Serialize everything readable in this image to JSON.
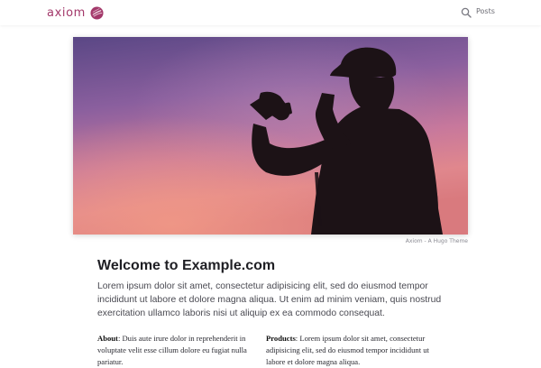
{
  "header": {
    "brand": "axiom",
    "brand_color": "#a3386a",
    "icons": {
      "logo": "axiom-logo-icon",
      "search": "search-icon"
    },
    "nav": [
      {
        "label": "Posts"
      }
    ]
  },
  "hero": {
    "image": "sunset-photographer-silhouette",
    "caption": "Axiom - A Hugo Theme"
  },
  "main": {
    "title": "Welcome to Example.com",
    "intro": "Lorem ipsum dolor sit amet, consectetur adipisicing elit, sed do eiusmod tempor incididunt ut labore et dolore magna aliqua. Ut enim ad minim veniam, quis nostrud exercitation ullamco laboris nisi ut aliquip ex ea commodo consequat.",
    "columns": [
      {
        "term": "About",
        "text": ": Duis aute irure dolor in reprehenderit in voluptate velit esse cillum dolore eu fugiat nulla pariatur."
      },
      {
        "term": "Products",
        "text": ": Lorem ipsum dolor sit amet, consectetur adipisicing elit, sed do eiusmod tempor incididunt ut labore et dolore magna aliqua."
      }
    ]
  }
}
